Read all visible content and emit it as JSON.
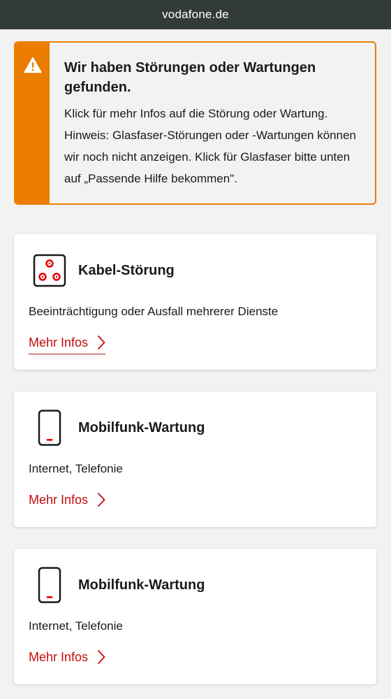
{
  "browser": {
    "url": "vodafone.de"
  },
  "alert": {
    "icon": "warning-triangle-icon",
    "color": "#eb7d00",
    "title": "Wir haben Störungen oder Wartungen gefunden.",
    "text": "Klick für mehr Infos auf die Störung oder Wartung. Hinweis: Glasfaser-Störungen oder -Wartungen können wir noch nicht anzeigen. Klick für Glasfaser bitte unten auf „Passende Hilfe bekommen\"."
  },
  "cards": [
    {
      "icon": "cable-box-icon",
      "title": "Kabel-Störung",
      "description": "Beeinträchtigung oder Ausfall mehrerer Dienste",
      "link": "Mehr Infos"
    },
    {
      "icon": "mobile-phone-icon",
      "title": "Mobilfunk-Wartung",
      "description": "Internet, Telefonie",
      "link": "Mehr Infos"
    },
    {
      "icon": "mobile-phone-icon",
      "title": "Mobilfunk-Wartung",
      "description": "Internet, Telefonie",
      "link": "Mehr Infos"
    }
  ],
  "colors": {
    "accent": "#e60000",
    "link": "#c50c0c",
    "url_bar": "#323b39"
  }
}
